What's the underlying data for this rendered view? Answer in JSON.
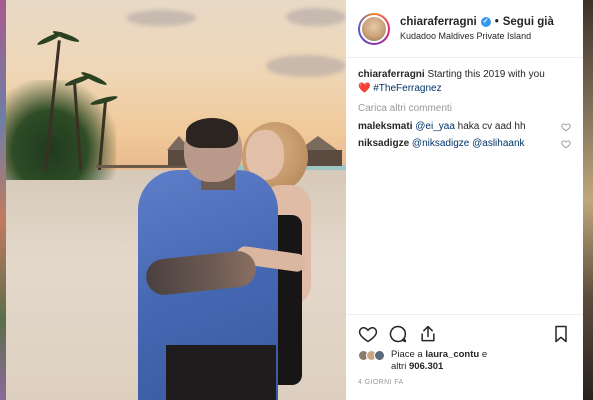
{
  "post": {
    "username": "chiaraferragni",
    "separator": "•",
    "follow_label": "Segui già",
    "location": "Kudadoo Maldives Private Island",
    "verified_glyph": "✓"
  },
  "caption": {
    "username": "chiaraferragni",
    "text": "Starting this 2019 with you",
    "emoji": "❤️",
    "hashtag": "#TheFerragnez"
  },
  "load_more_label": "Carica altri commenti",
  "comments": [
    {
      "username": "maleksmati",
      "mention": "@ei_yaa",
      "text": "haka cv aad hh"
    },
    {
      "username": "niksadigze",
      "mention": "@niksadigze",
      "mention2": "@aslihaank"
    }
  ],
  "actions": {
    "like_icon": "heart-icon",
    "comment_icon": "comment-icon",
    "share_icon": "share-icon",
    "save_icon": "bookmark-icon"
  },
  "likes": {
    "prefix": "Piace a",
    "user": "laura_contu",
    "middle": "e",
    "suffix_prefix": "altri",
    "count": "906.301"
  },
  "timestamp": "4 GIORNI FA",
  "colors": {
    "link": "#003569",
    "muted": "#999999",
    "text": "#262626",
    "verified": "#3897f0",
    "heart": "#ed4956"
  }
}
